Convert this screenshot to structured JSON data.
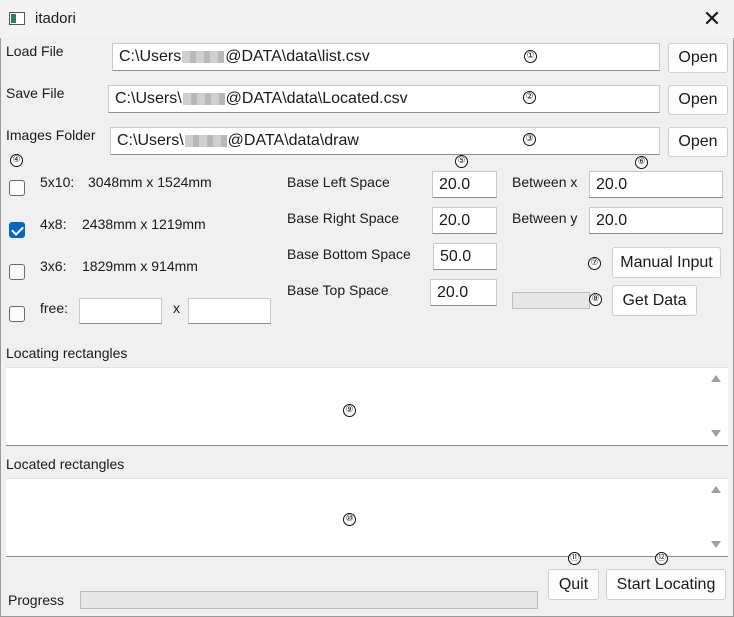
{
  "window": {
    "title": "itadori",
    "close_symbol": "✕"
  },
  "files": {
    "load_label": "Load File",
    "load_path_prefix": "C:\\Users",
    "load_path_suffix": "@DATA\\data\\list.csv",
    "save_label": "Save File",
    "save_path_prefix": "C:\\Users\\",
    "save_path_suffix": "@DATA\\data\\Located.csv",
    "images_label": "Images Folder",
    "images_path_prefix": "C:\\Users\\",
    "images_path_suffix": "@DATA\\data\\draw",
    "open_label": "Open"
  },
  "markers": [
    "①",
    "②",
    "③",
    "④",
    "⑤",
    "⑥",
    "⑦",
    "⑧",
    "⑨",
    "⑩",
    "⑪",
    "⑫"
  ],
  "sizes": {
    "s1_name": "5x10:",
    "s1_dims": "3048mm x 1524mm",
    "s1_checked": false,
    "s2_name": "4x8:",
    "s2_dims": "2438mm x 1219mm",
    "s2_checked": true,
    "s3_name": "3x6:",
    "s3_dims": "1829mm x 914mm",
    "s3_checked": false,
    "free_label": "free:",
    "free_x": "x",
    "free_checked": false,
    "free_width": "",
    "free_height": ""
  },
  "spaces": {
    "left_label": "Base Left Space",
    "left_value": "20.0",
    "right_label": "Base Right Space",
    "right_value": "20.0",
    "bottom_label": "Base Bottom Space",
    "bottom_value": "50.0",
    "top_label": "Base Top Space",
    "top_value": "20.0"
  },
  "between": {
    "x_label": "Between x",
    "x_value": "20.0",
    "y_label": "Between y",
    "y_value": "20.0"
  },
  "actions": {
    "manual_input": "Manual Input",
    "get_data": "Get Data",
    "get_data_progress": 0,
    "quit": "Quit",
    "start_locating": "Start Locating"
  },
  "lists": {
    "locating_label": "Locating rectangles",
    "located_label": "Located rectangles"
  },
  "footer": {
    "progress_label": "Progress",
    "progress_value": 0
  }
}
